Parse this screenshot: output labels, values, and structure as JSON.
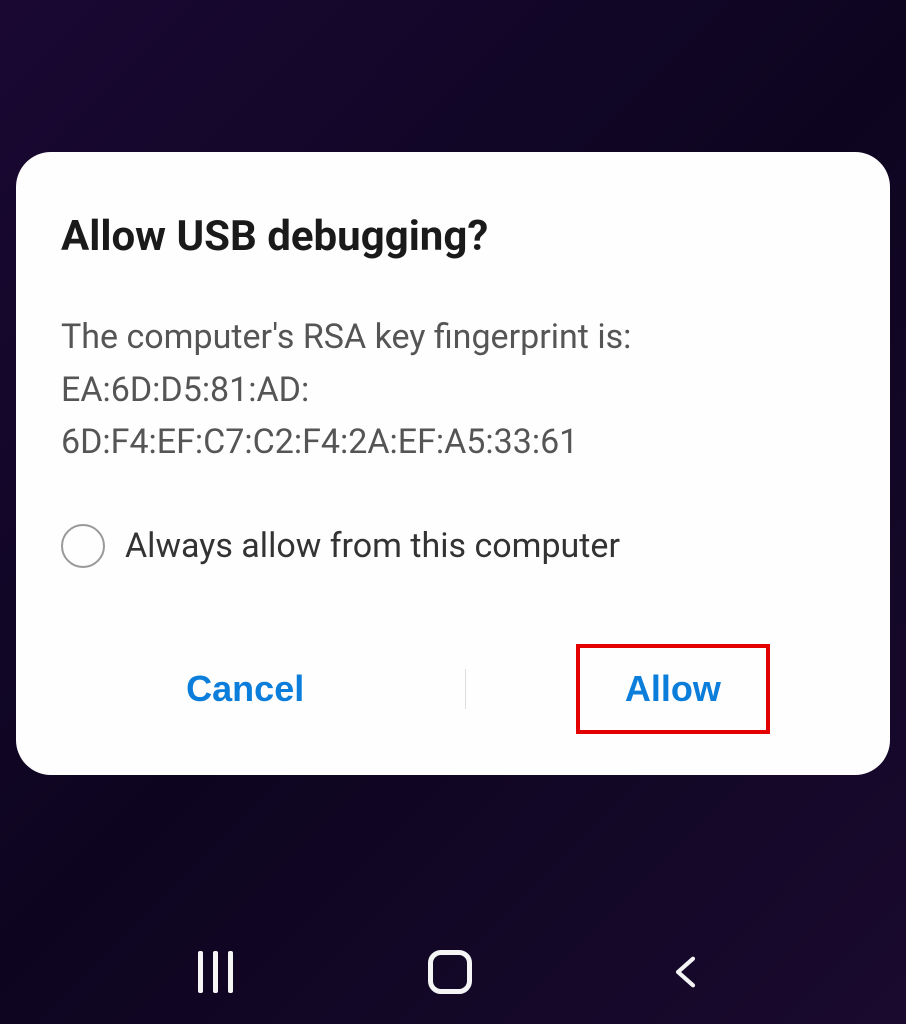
{
  "dialog": {
    "title": "Allow USB debugging?",
    "message": "The computer's RSA key fingerprint is:\nEA:6D:D5:81:AD:\n6D:F4:EF:C7:C2:F4:2A:EF:A5:33:61",
    "checkbox_label": "Always allow from this computer",
    "cancel_label": "Cancel",
    "allow_label": "Allow"
  },
  "highlight": {
    "target": "allow-button"
  }
}
